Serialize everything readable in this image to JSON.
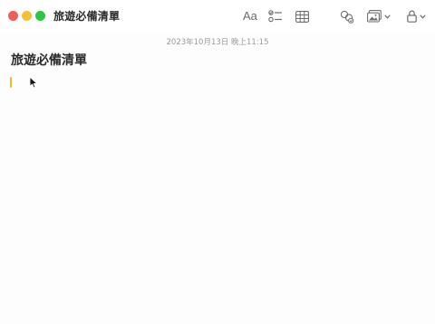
{
  "window": {
    "title": "旅遊必備清單"
  },
  "toolbar": {
    "format_label": "Aa",
    "icons": [
      "format-text-icon",
      "checklist-icon",
      "table-icon",
      "collaborate-icon",
      "media-icon",
      "lock-icon"
    ]
  },
  "note": {
    "timestamp": "2023年10月13日 晚上11:15",
    "title": "旅遊必備清單"
  },
  "colors": {
    "close": "#ee5f57",
    "minimize": "#f6be32",
    "maximize": "#2bc744",
    "caret": "#f2b82c"
  }
}
